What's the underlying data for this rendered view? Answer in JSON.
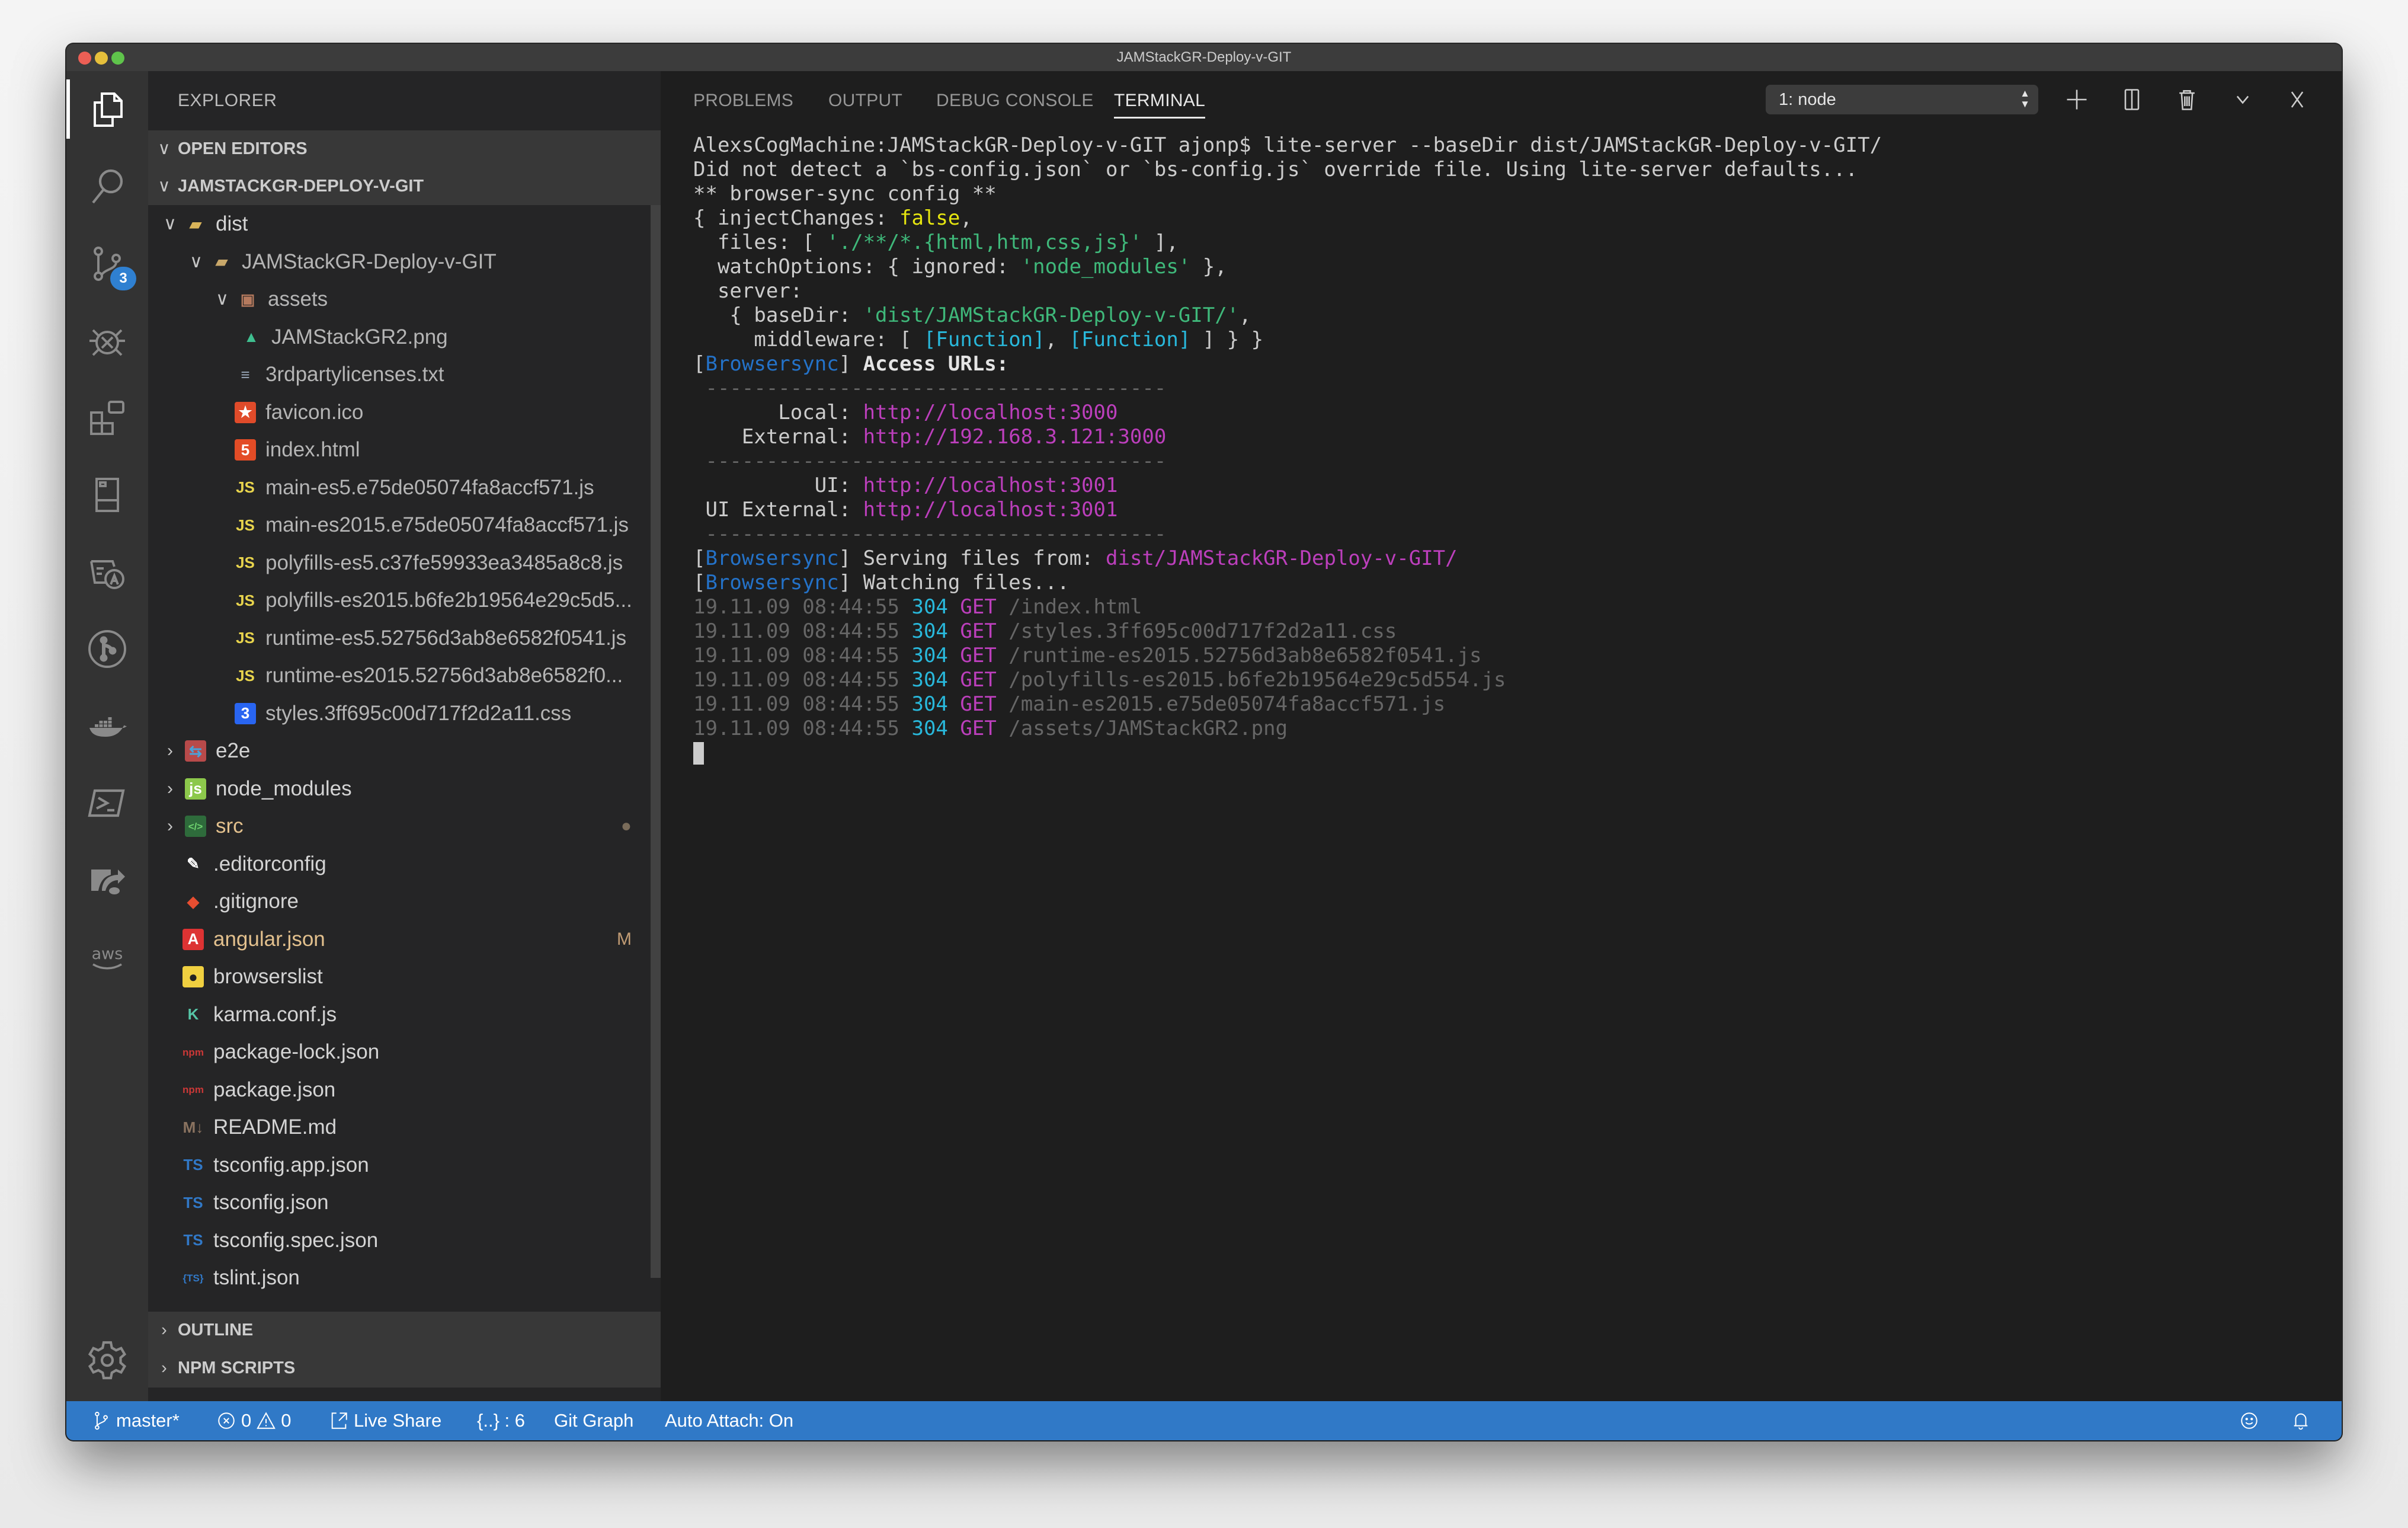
{
  "window": {
    "title": "JAMStackGR-Deploy-v-GIT"
  },
  "activity_bar": {
    "items": [
      {
        "name": "explorer",
        "icon": "files-icon",
        "active": true
      },
      {
        "name": "search",
        "icon": "search-icon"
      },
      {
        "name": "source-control",
        "icon": "source-control-icon",
        "badge": "3"
      },
      {
        "name": "debug",
        "icon": "debug-icon"
      },
      {
        "name": "extensions",
        "icon": "extensions-icon"
      },
      {
        "name": "remote-explorer",
        "icon": "remote-explorer-icon"
      },
      {
        "name": "translate",
        "icon": "translate-icon"
      },
      {
        "name": "git-graph",
        "icon": "git-graph-icon"
      },
      {
        "name": "docker",
        "icon": "docker-icon"
      },
      {
        "name": "powershell",
        "icon": "powershell-icon"
      },
      {
        "name": "azure-deploy",
        "icon": "deploy-icon"
      },
      {
        "name": "aws",
        "icon": "aws-icon",
        "label": "aws"
      }
    ],
    "settings_icon": "gear-icon"
  },
  "sidebar": {
    "title": "EXPLORER",
    "sections": {
      "open_editors": "OPEN EDITORS",
      "project": "JAMSTACKGR-DEPLOY-V-GIT",
      "outline": "OUTLINE",
      "npm_scripts": "NPM SCRIPTS"
    },
    "tree": [
      {
        "label": "dist",
        "depth": 1,
        "type": "folder",
        "expanded": true,
        "icon": "folder-dist-icon"
      },
      {
        "label": "JAMStackGR-Deploy-v-GIT",
        "depth": 2,
        "type": "folder",
        "expanded": true,
        "icon": "folder-icon"
      },
      {
        "label": "assets",
        "depth": 3,
        "type": "folder",
        "expanded": true,
        "icon": "folder-assets-icon"
      },
      {
        "label": "JAMStackGR2.png",
        "depth": 4,
        "type": "file",
        "icon": "image-icon"
      },
      {
        "label": "3rdpartylicenses.txt",
        "depth": 3,
        "type": "file",
        "icon": "text-file-icon"
      },
      {
        "label": "favicon.ico",
        "depth": 3,
        "type": "file",
        "icon": "favicon-icon"
      },
      {
        "label": "index.html",
        "depth": 3,
        "type": "file",
        "icon": "html5-icon"
      },
      {
        "label": "main-es5.e75de05074fa8accf571.js",
        "depth": 3,
        "type": "file",
        "icon": "js-icon"
      },
      {
        "label": "main-es2015.e75de05074fa8accf571.js",
        "depth": 3,
        "type": "file",
        "icon": "js-icon"
      },
      {
        "label": "polyfills-es5.c37fe59933ea3485a8c8.js",
        "depth": 3,
        "type": "file",
        "icon": "js-icon"
      },
      {
        "label": "polyfills-es2015.b6fe2b19564e29c5d5...",
        "depth": 3,
        "type": "file",
        "icon": "js-icon"
      },
      {
        "label": "runtime-es5.52756d3ab8e6582f0541.js",
        "depth": 3,
        "type": "file",
        "icon": "js-icon"
      },
      {
        "label": "runtime-es2015.52756d3ab8e6582f0...",
        "depth": 3,
        "type": "file",
        "icon": "js-icon"
      },
      {
        "label": "styles.3ff695c00d717f2d2a11.css",
        "depth": 3,
        "type": "file",
        "icon": "css3-icon"
      },
      {
        "label": "e2e",
        "depth": 1,
        "type": "folder",
        "expanded": false,
        "icon": "folder-e2e-icon"
      },
      {
        "label": "node_modules",
        "depth": 1,
        "type": "folder",
        "expanded": false,
        "icon": "folder-node-icon"
      },
      {
        "label": "src",
        "depth": 1,
        "type": "folder",
        "expanded": false,
        "icon": "folder-src-icon",
        "decoration": "●",
        "modified": true
      },
      {
        "label": ".editorconfig",
        "depth": 1,
        "type": "file",
        "icon": "editorconfig-icon"
      },
      {
        "label": ".gitignore",
        "depth": 1,
        "type": "file",
        "icon": "git-icon"
      },
      {
        "label": "angular.json",
        "depth": 1,
        "type": "file",
        "icon": "angular-icon",
        "decoration": "M",
        "modified": true
      },
      {
        "label": "browserslist",
        "depth": 1,
        "type": "file",
        "icon": "browserslist-icon"
      },
      {
        "label": "karma.conf.js",
        "depth": 1,
        "type": "file",
        "icon": "karma-icon"
      },
      {
        "label": "package-lock.json",
        "depth": 1,
        "type": "file",
        "icon": "npm-icon"
      },
      {
        "label": "package.json",
        "depth": 1,
        "type": "file",
        "icon": "npm-icon"
      },
      {
        "label": "README.md",
        "depth": 1,
        "type": "file",
        "icon": "markdown-icon"
      },
      {
        "label": "tsconfig.app.json",
        "depth": 1,
        "type": "file",
        "icon": "tsconfig-icon"
      },
      {
        "label": "tsconfig.json",
        "depth": 1,
        "type": "file",
        "icon": "tsconfig-icon"
      },
      {
        "label": "tsconfig.spec.json",
        "depth": 1,
        "type": "file",
        "icon": "tsconfig-icon"
      },
      {
        "label": "tslint.json",
        "depth": 1,
        "type": "file",
        "icon": "tslint-icon"
      }
    ]
  },
  "panel": {
    "tabs": [
      {
        "label": "PROBLEMS",
        "active": false
      },
      {
        "label": "OUTPUT",
        "active": false
      },
      {
        "label": "DEBUG CONSOLE",
        "active": false
      },
      {
        "label": "TERMINAL",
        "active": true
      }
    ],
    "terminal_select": "1: node",
    "actions": [
      "new-terminal",
      "split-terminal",
      "kill-terminal",
      "maximize-panel",
      "close-panel"
    ]
  },
  "terminal": {
    "lines": [
      [
        {
          "t": "AlexsCogMachine:JAMStackGR-Deploy-v-GIT ajonp$ lite-server --baseDir dist/JAMStackGR-Deploy-v-GIT/"
        }
      ],
      [
        {
          "t": "Did not detect a `bs-config.json` or `bs-config.js` override file. Using lite-server defaults..."
        }
      ],
      [
        {
          "t": "** browser-sync config **"
        }
      ],
      [
        {
          "t": "{ injectChanges: "
        },
        {
          "t": "false",
          "c": "yellow"
        },
        {
          "t": ","
        }
      ],
      [
        {
          "t": "  files: [ "
        },
        {
          "t": "'./**/*.{html,htm,css,js}'",
          "c": "green2"
        },
        {
          "t": " ],"
        }
      ],
      [
        {
          "t": "  watchOptions: { ignored: "
        },
        {
          "t": "'node_modules'",
          "c": "green2"
        },
        {
          "t": " },"
        }
      ],
      [
        {
          "t": "  server:"
        }
      ],
      [
        {
          "t": "   { baseDir: "
        },
        {
          "t": "'dist/JAMStackGR-Deploy-v-GIT/'",
          "c": "green2"
        },
        {
          "t": ","
        }
      ],
      [
        {
          "t": "     middleware: [ "
        },
        {
          "t": "[Function]",
          "c": "cyan"
        },
        {
          "t": ", "
        },
        {
          "t": "[Function]",
          "c": "cyan"
        },
        {
          "t": " ] } }"
        }
      ],
      [
        {
          "t": "["
        },
        {
          "t": "Browsersync",
          "c": "blue"
        },
        {
          "t": "] "
        },
        {
          "t": "Access URLs:",
          "c": "bold"
        }
      ],
      [
        {
          "t": " --------------------------------------",
          "c": "gray"
        }
      ],
      [
        {
          "t": "       Local: "
        },
        {
          "t": "http://localhost:3000",
          "c": "mag"
        }
      ],
      [
        {
          "t": "    External: "
        },
        {
          "t": "http://192.168.3.121:3000",
          "c": "mag"
        }
      ],
      [
        {
          "t": " --------------------------------------",
          "c": "gray"
        }
      ],
      [
        {
          "t": "          UI: "
        },
        {
          "t": "http://localhost:3001",
          "c": "mag"
        }
      ],
      [
        {
          "t": " UI External: "
        },
        {
          "t": "http://localhost:3001",
          "c": "mag"
        }
      ],
      [
        {
          "t": " --------------------------------------",
          "c": "gray"
        }
      ],
      [
        {
          "t": "["
        },
        {
          "t": "Browsersync",
          "c": "blue"
        },
        {
          "t": "] Serving files from: "
        },
        {
          "t": "dist/JAMStackGR-Deploy-v-GIT/",
          "c": "mag"
        }
      ],
      [
        {
          "t": "["
        },
        {
          "t": "Browsersync",
          "c": "blue"
        },
        {
          "t": "] Watching files..."
        }
      ],
      [
        {
          "t": "19.11.09 08:44:55 ",
          "c": "gray"
        },
        {
          "t": "304",
          "c": "cyan"
        },
        {
          "t": " "
        },
        {
          "t": "GET",
          "c": "mag"
        },
        {
          "t": " /index.html",
          "c": "gray"
        }
      ],
      [
        {
          "t": "19.11.09 08:44:55 ",
          "c": "gray"
        },
        {
          "t": "304",
          "c": "cyan"
        },
        {
          "t": " "
        },
        {
          "t": "GET",
          "c": "mag"
        },
        {
          "t": " /styles.3ff695c00d717f2d2a11.css",
          "c": "gray"
        }
      ],
      [
        {
          "t": "19.11.09 08:44:55 ",
          "c": "gray"
        },
        {
          "t": "304",
          "c": "cyan"
        },
        {
          "t": " "
        },
        {
          "t": "GET",
          "c": "mag"
        },
        {
          "t": " /runtime-es2015.52756d3ab8e6582f0541.js",
          "c": "gray"
        }
      ],
      [
        {
          "t": "19.11.09 08:44:55 ",
          "c": "gray"
        },
        {
          "t": "304",
          "c": "cyan"
        },
        {
          "t": " "
        },
        {
          "t": "GET",
          "c": "mag"
        },
        {
          "t": " /polyfills-es2015.b6fe2b19564e29c5d554.js",
          "c": "gray"
        }
      ],
      [
        {
          "t": "19.11.09 08:44:55 ",
          "c": "gray"
        },
        {
          "t": "304",
          "c": "cyan"
        },
        {
          "t": " "
        },
        {
          "t": "GET",
          "c": "mag"
        },
        {
          "t": " /main-es2015.e75de05074fa8accf571.js",
          "c": "gray"
        }
      ],
      [
        {
          "t": "19.11.09 08:44:55 ",
          "c": "gray"
        },
        {
          "t": "304",
          "c": "cyan"
        },
        {
          "t": " "
        },
        {
          "t": "GET",
          "c": "mag"
        },
        {
          "t": " /assets/JAMStackGR2.png",
          "c": "gray"
        }
      ]
    ]
  },
  "statusbar": {
    "branch": "master*",
    "errors": "0",
    "warnings": "0",
    "live_share": "Live Share",
    "bracket_pairs": "{..} : 6",
    "git_graph": "Git Graph",
    "auto_attach": "Auto Attach: On",
    "accent": "#3079c7"
  }
}
